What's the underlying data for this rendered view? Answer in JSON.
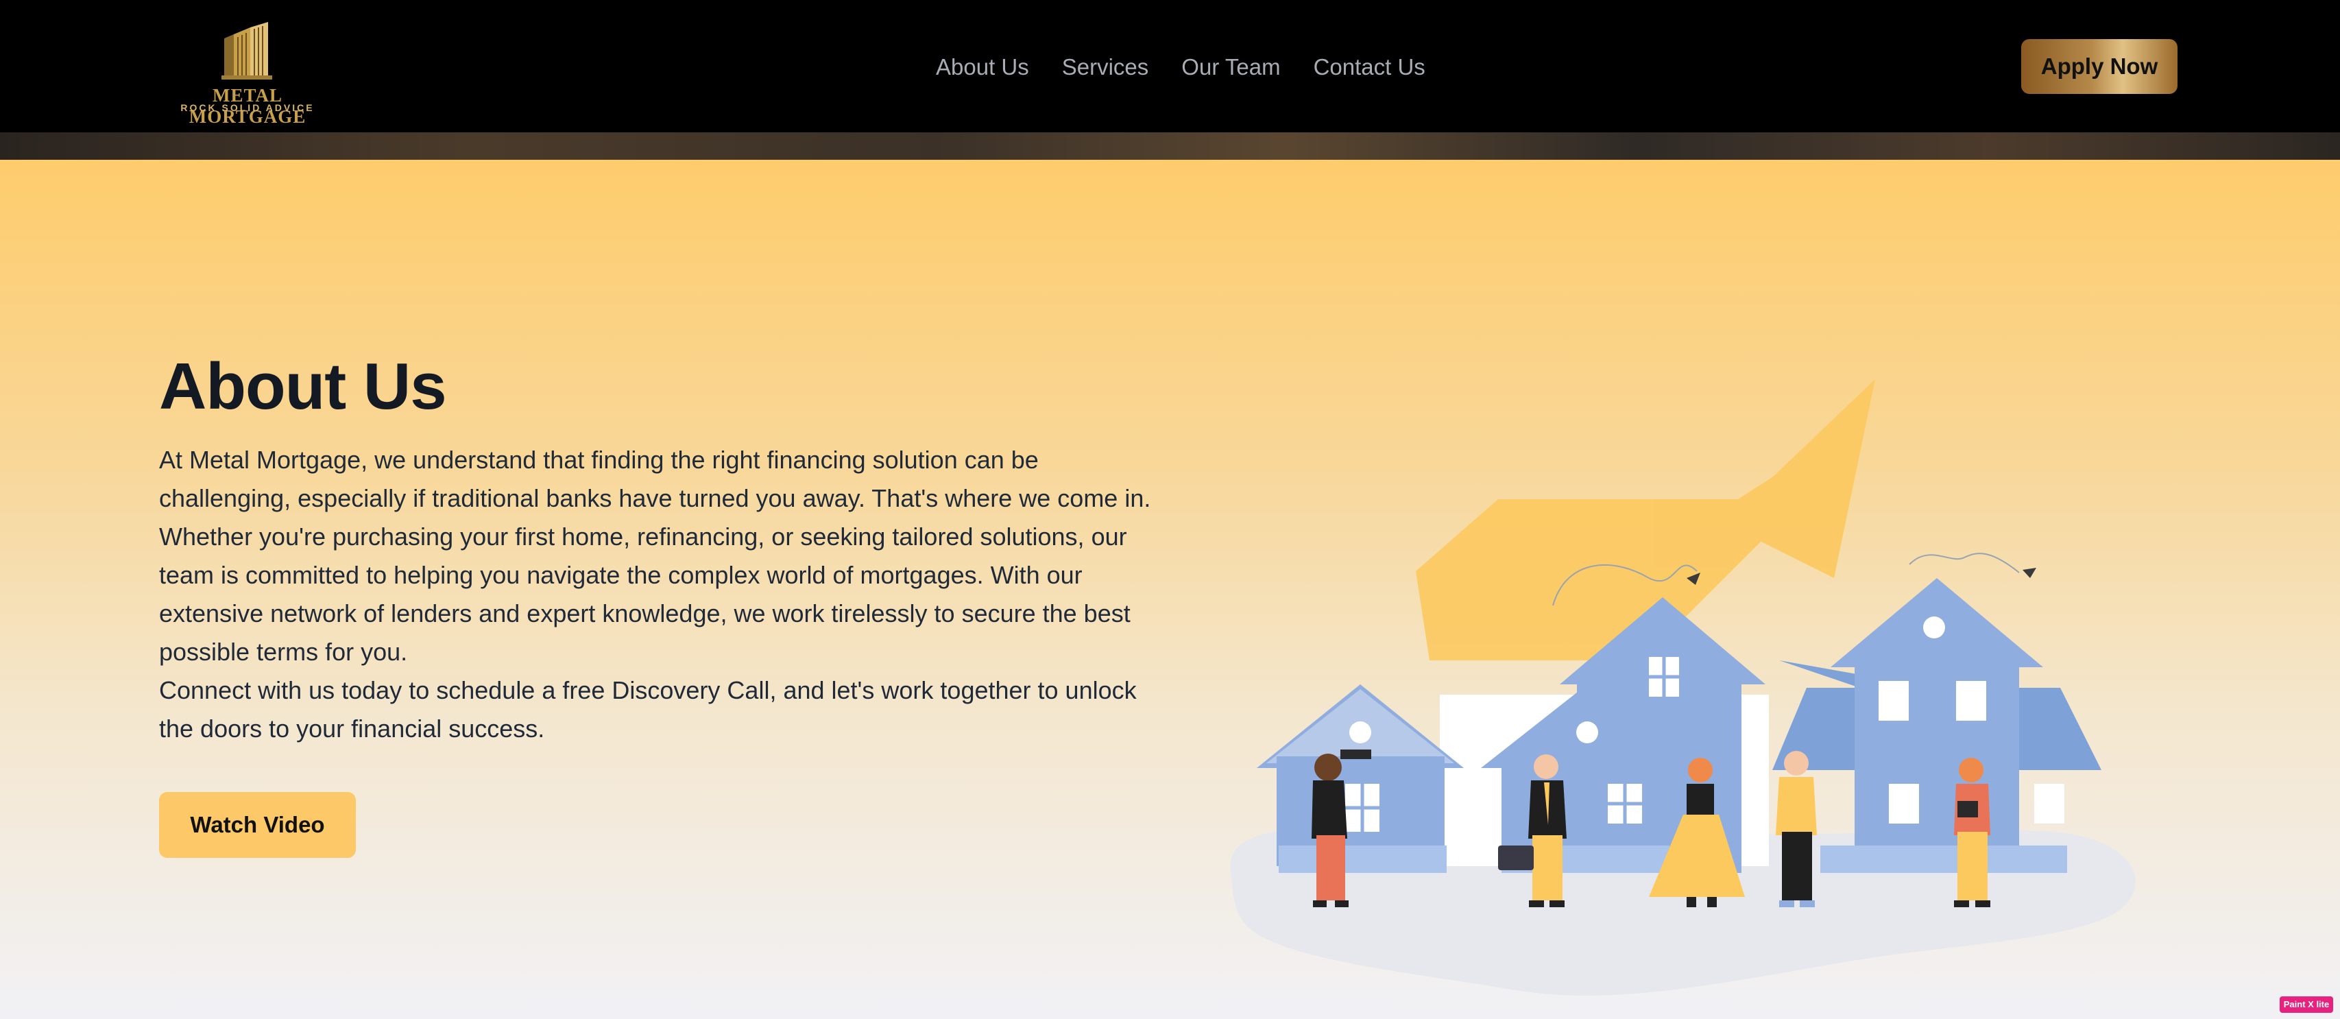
{
  "brand": {
    "name": "METAL MORTGAGE",
    "tagline": "ROCK SOLID ADVICE"
  },
  "nav": {
    "items": [
      {
        "label": "About Us"
      },
      {
        "label": "Services"
      },
      {
        "label": "Our Team"
      },
      {
        "label": "Contact Us"
      }
    ],
    "cta_label": "Apply Now"
  },
  "hero": {
    "title": "About Us",
    "paragraph_1": "At Metal Mortgage, we understand that finding the right financing solution can be challenging, especially if traditional banks have turned you away. That's where we come in. Whether you're purchasing your first home, refinancing, or seeking tailored solutions, our team is committed to helping you navigate the complex world of mortgages. With our extensive network of lenders and expert knowledge, we work tirelessly to secure the best possible terms for you.",
    "paragraph_2": "Connect with us today to schedule a free Discovery Call, and let's work together to unlock the doors to your financial success.",
    "button_label": "Watch Video"
  },
  "corner_badge": "Paint X lite",
  "colors": {
    "accent": "#fdc867",
    "gold": "#c9a04a",
    "house_blue": "#8fadde",
    "text_dark": "#141a24"
  }
}
